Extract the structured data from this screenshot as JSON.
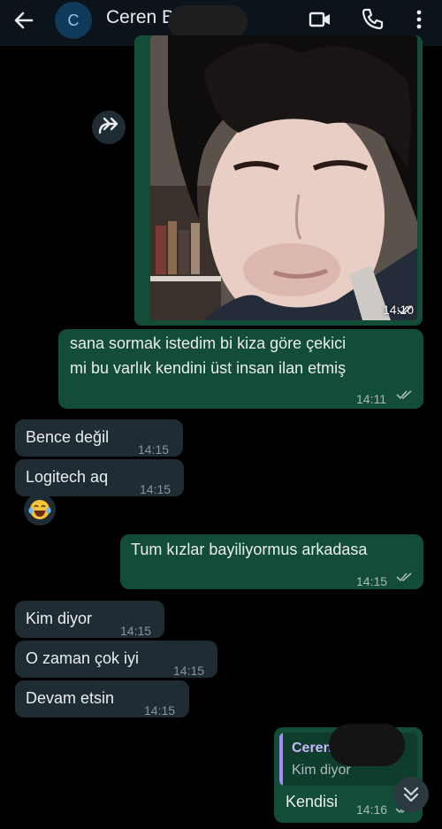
{
  "header": {
    "avatar_letter": "C",
    "contact_name": "Ceren B",
    "icons": [
      "back-arrow-icon",
      "video-call-icon",
      "phone-icon",
      "more-vertical-icon"
    ]
  },
  "messages": [
    {
      "id": "m0",
      "direction": "outgoing",
      "type": "image",
      "time": "14:10",
      "status": "read"
    },
    {
      "id": "m1",
      "direction": "outgoing",
      "text1": "sana sormak istedim bi kiza göre çekici",
      "text2": "mi bu varlık kendini üst insan ilan etmiş",
      "time": "14:11",
      "status": "read"
    },
    {
      "id": "m2",
      "direction": "incoming",
      "text": "Bence değil",
      "time": "14:15"
    },
    {
      "id": "m3",
      "direction": "incoming",
      "text": "Logitech aq",
      "time": "14:15"
    },
    {
      "id": "m4",
      "direction": "incoming",
      "type": "reaction",
      "emoji": "😂"
    },
    {
      "id": "m5",
      "direction": "outgoing",
      "text": "Tum kızlar bayiliyormus arkadasa",
      "time": "14:15",
      "status": "read"
    },
    {
      "id": "m6",
      "direction": "incoming",
      "text": "Kim diyor",
      "time": "14:15"
    },
    {
      "id": "m7",
      "direction": "incoming",
      "text": "O zaman çok iyi",
      "time": "14:15"
    },
    {
      "id": "m8",
      "direction": "incoming",
      "text": "Devam etsin",
      "time": "14:15"
    },
    {
      "id": "m9",
      "direction": "outgoing",
      "quote_name": "Ceren B",
      "quote_text": "Kim diyor",
      "text": "Kendisi",
      "time": "14:16",
      "status": "read"
    }
  ],
  "colors": {
    "background": "#000000",
    "header": "#0b141a",
    "outgoing_bubble": "#144d37",
    "incoming_bubble": "#1f2c33",
    "read_tick": "#a8bcb4",
    "quote_accent": "#a78bfa"
  }
}
